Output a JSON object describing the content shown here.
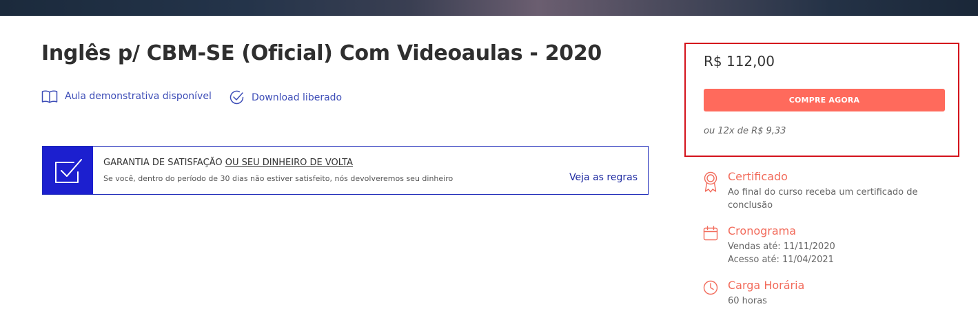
{
  "course": {
    "title": "Inglês p/ CBM-SE (Oficial) Com Videoaulas - 2020"
  },
  "features": {
    "demo": {
      "label": "Aula demonstrativa disponível",
      "icon": "open-book-icon"
    },
    "download": {
      "label": "Download liberado",
      "icon": "check-circle-icon"
    }
  },
  "guarantee": {
    "title_part1": "GARANTIA DE SATISFAÇÃO",
    "title_part2": "OU SEU DINHEIRO DE VOLTA",
    "description": "Se você, dentro do período de 30 dias não estiver satisfeito, nós devolveremos seu dinheiro",
    "link_label": "Veja as regras",
    "icon": "checkbox-icon"
  },
  "purchase": {
    "price": "R$ 112,00",
    "button_label": "COMPRE AGORA",
    "installments": "ou 12x de R$ 9,33"
  },
  "info": {
    "certificate": {
      "title": "Certificado",
      "lines": [
        "Ao final do curso receba um certificado de",
        "conclusão"
      ],
      "icon": "ribbon-award-icon"
    },
    "schedule": {
      "title": "Cronograma",
      "lines": [
        "Vendas até: 11/11/2020",
        "Acesso até: 11/04/2021"
      ],
      "icon": "calendar-icon"
    },
    "workload": {
      "title": "Carga Horária",
      "lines": [
        "60 horas"
      ],
      "icon": "clock-icon"
    }
  },
  "colors": {
    "accent": "#ff6a5c",
    "link": "#3d4db7",
    "guarantee_blue": "#1c1fcf",
    "highlight_border": "#d4131c",
    "info_title": "#f26b5b"
  }
}
